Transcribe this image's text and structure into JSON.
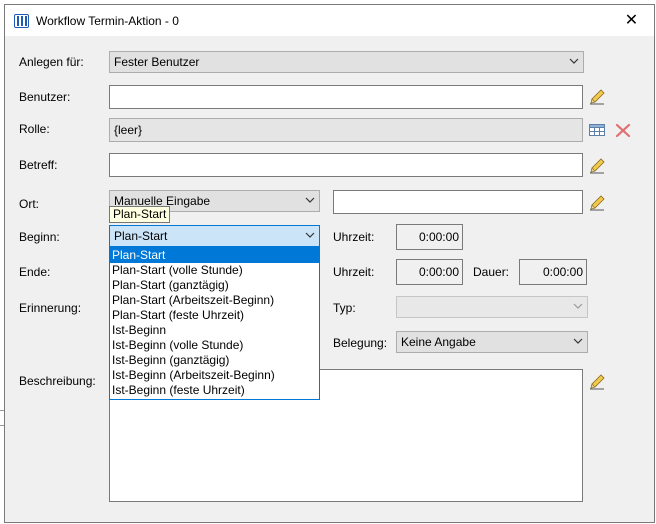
{
  "window": {
    "title": "Workflow Termin-Aktion - 0",
    "close_glyph": "✕"
  },
  "form": {
    "anlegen_fuer": {
      "label": "Anlegen für:",
      "value": "Fester Benutzer"
    },
    "benutzer": {
      "label": "Benutzer:",
      "value": ""
    },
    "rolle": {
      "label": "Rolle:",
      "value": "{leer}"
    },
    "betreff": {
      "label": "Betreff:",
      "value": ""
    },
    "ort": {
      "label": "Ort:",
      "value": "Manuelle Eingabe",
      "text": ""
    },
    "beginn": {
      "label": "Beginn:",
      "value": "Plan-Start",
      "uhrzeit_label": "Uhrzeit:",
      "uhrzeit": "0:00:00"
    },
    "ende": {
      "label": "Ende:",
      "uhrzeit_label": "Uhrzeit:",
      "uhrzeit": "0:00:00",
      "dauer_label": "Dauer:",
      "dauer": "0:00:00"
    },
    "erinnerung": {
      "label": "Erinnerung:",
      "typ_label": "Typ:",
      "typ": ""
    },
    "belegung": {
      "label": "Belegung:",
      "value": "Keine Angabe"
    },
    "beschreibung": {
      "label": "Beschreibung:",
      "value": ""
    }
  },
  "tooltip": {
    "text": "Plan-Start"
  },
  "dropdown": {
    "items": [
      "Plan-Start",
      "Plan-Start (volle Stunde)",
      "Plan-Start (ganztägig)",
      "Plan-Start (Arbeitszeit-Beginn)",
      "Plan-Start (feste Uhrzeit)",
      "Ist-Beginn",
      "Ist-Beginn (volle Stunde)",
      "Ist-Beginn (ganztägig)",
      "Ist-Beginn (Arbeitszeit-Beginn)",
      "Ist-Beginn (feste Uhrzeit)"
    ],
    "selected_index": 0
  },
  "icons": {
    "edit": "pencil-icon",
    "table": "table-icon",
    "clear": "red-x-icon",
    "app": "workflow-app-icon"
  },
  "colors": {
    "selection": "#0078d7",
    "focus_bg": "#cce4f7",
    "tooltip_bg": "#ffffe1"
  }
}
